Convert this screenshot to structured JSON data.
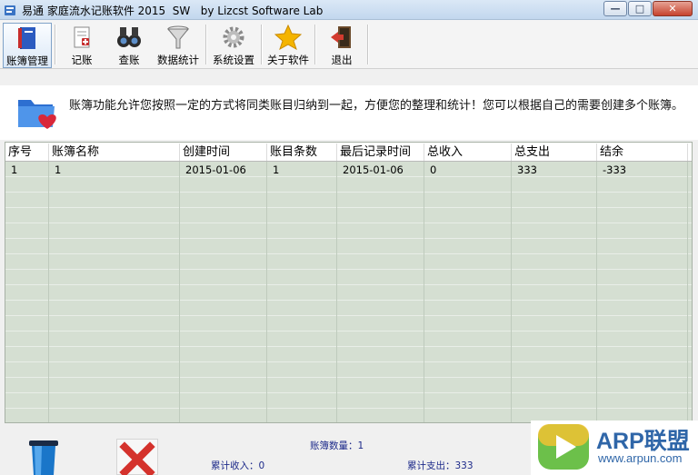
{
  "window": {
    "title": "易通 家庭流水记账软件 2015  SW   by Lizcst Software Lab",
    "controls": {
      "minimize": "—",
      "maximize": "□",
      "close": "✕"
    }
  },
  "toolbar": {
    "items": [
      {
        "label": "账簿管理",
        "icon": "ledger-book-icon",
        "active": true
      },
      {
        "label": "记账",
        "icon": "record-entry-icon"
      },
      {
        "label": "查账",
        "icon": "binoculars-icon"
      },
      {
        "label": "数据统计",
        "icon": "funnel-icon"
      },
      {
        "label": "系统设置",
        "icon": "gear-icon"
      },
      {
        "label": "关于软件",
        "icon": "star-icon"
      },
      {
        "label": "退出",
        "icon": "exit-door-icon"
      }
    ]
  },
  "info": {
    "icon": "folder-heart-icon",
    "text": "账簿功能允许您按照一定的方式将同类账目归纳到一起，方便您的整理和统计！您可以根据自己的需要创建多个账簿。"
  },
  "table": {
    "headers": [
      "序号",
      "账簿名称",
      "创建时间",
      "账目条数",
      "最后记录时间",
      "总收入",
      "总支出",
      "结余"
    ],
    "rows": [
      [
        "1",
        "1",
        "2015-01-06",
        "1",
        "2015-01-06",
        "0",
        "333",
        "-333"
      ]
    ]
  },
  "footer": {
    "delete_icon": "trash-bin-icon",
    "cancel_icon": "red-x-icon",
    "ledger_count_label": "账簿数量：1",
    "total_income_label": "累计收入：0",
    "total_expense_label": "累计支出：333"
  },
  "watermark": {
    "name": "ARP联盟",
    "url": "www.arpun.com"
  },
  "colors": {
    "grid_bg": "#d5dfd2",
    "stat_text": "#1d2a8a",
    "watermark_blue": "#2f66a8"
  }
}
